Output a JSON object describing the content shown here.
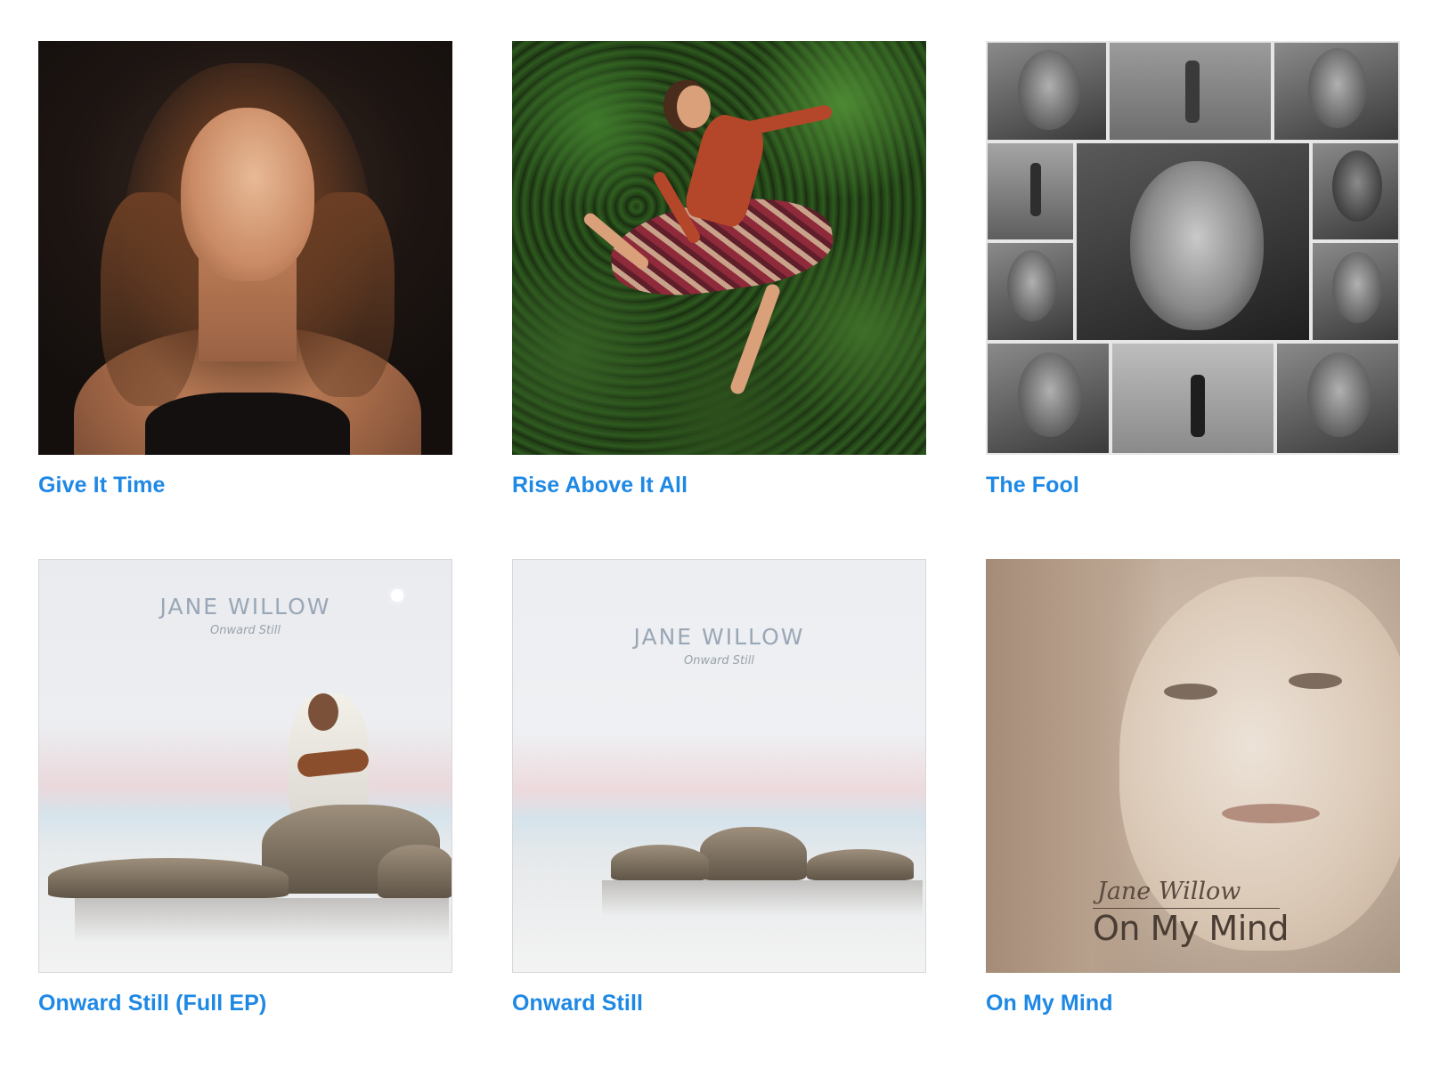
{
  "releases": [
    {
      "title": "Give It Time"
    },
    {
      "title": "Rise Above It All"
    },
    {
      "title": "The Fool"
    },
    {
      "title": "Onward Still (Full EP)",
      "cover_artist": "JANE WILLOW",
      "cover_subtitle": "Onward Still"
    },
    {
      "title": "Onward Still",
      "cover_artist": "JANE WILLOW",
      "cover_subtitle": "Onward Still"
    },
    {
      "title": "On My Mind",
      "cover_signature": "Jane Willow",
      "cover_text": "On My Mind"
    }
  ],
  "colors": {
    "link": "#1e88e5",
    "background": "#ffffff"
  }
}
